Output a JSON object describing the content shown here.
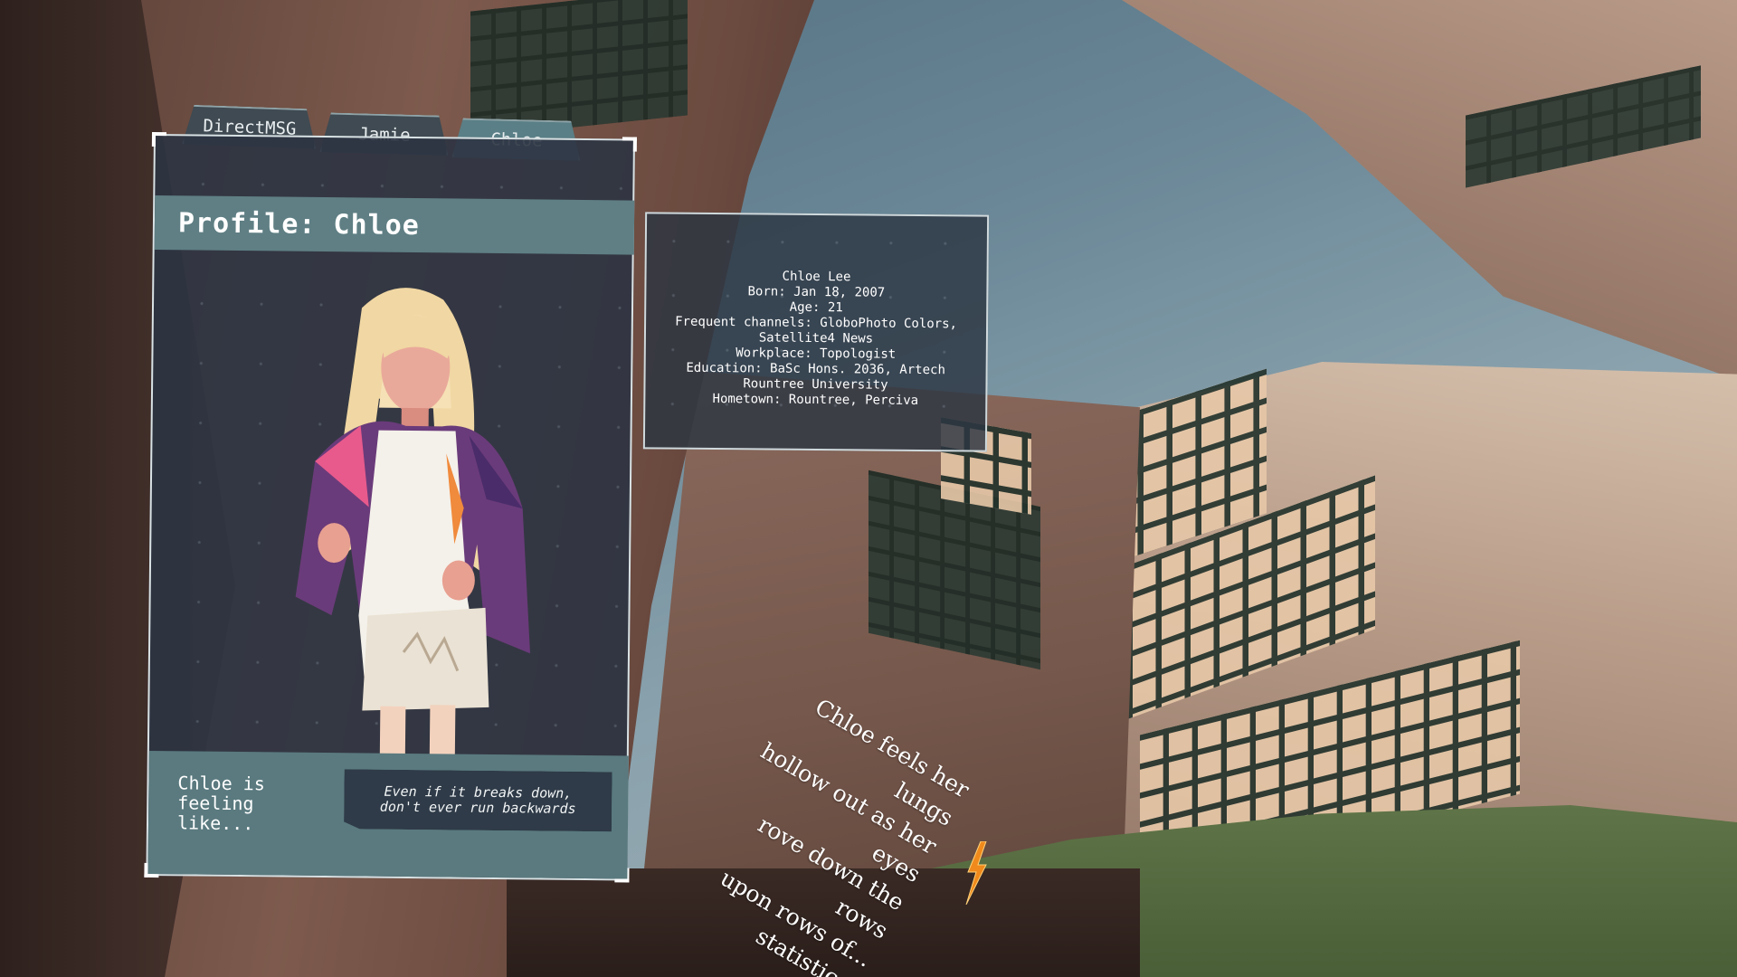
{
  "tabs": [
    {
      "label": "DirectMSG"
    },
    {
      "label": "Jamie"
    },
    {
      "label": "Chloe",
      "active": true
    }
  ],
  "profile": {
    "title": "Profile: Chloe",
    "feeling_label": "Chloe is feeling like...",
    "quote": "Even if it breaks down, don't ever run backwards"
  },
  "info": {
    "lines": [
      "Chloe Lee",
      "Born: Jan 18, 2007",
      "Age: 21",
      "Frequent channels: GloboPhoto Colors,",
      "Satellite4 News",
      "Workplace: Topologist",
      "Education: BaSc Hons. 2036, Artech",
      "Rountree University",
      "Hometown: Rountree, Perciva"
    ]
  },
  "narration": {
    "lines": [
      "Chloe feels her lungs",
      "hollow out as her eyes",
      "rove down the rows",
      "upon rows of...",
      "statistics."
    ]
  },
  "icons": {
    "portrait": "character-portrait",
    "bolt": "lightning-bolt-icon"
  },
  "colors": {
    "panel_bg": "#2c3442",
    "header": "#5f7f84",
    "active_tab": "#5a7f86",
    "bolt": "#f08a1c"
  }
}
